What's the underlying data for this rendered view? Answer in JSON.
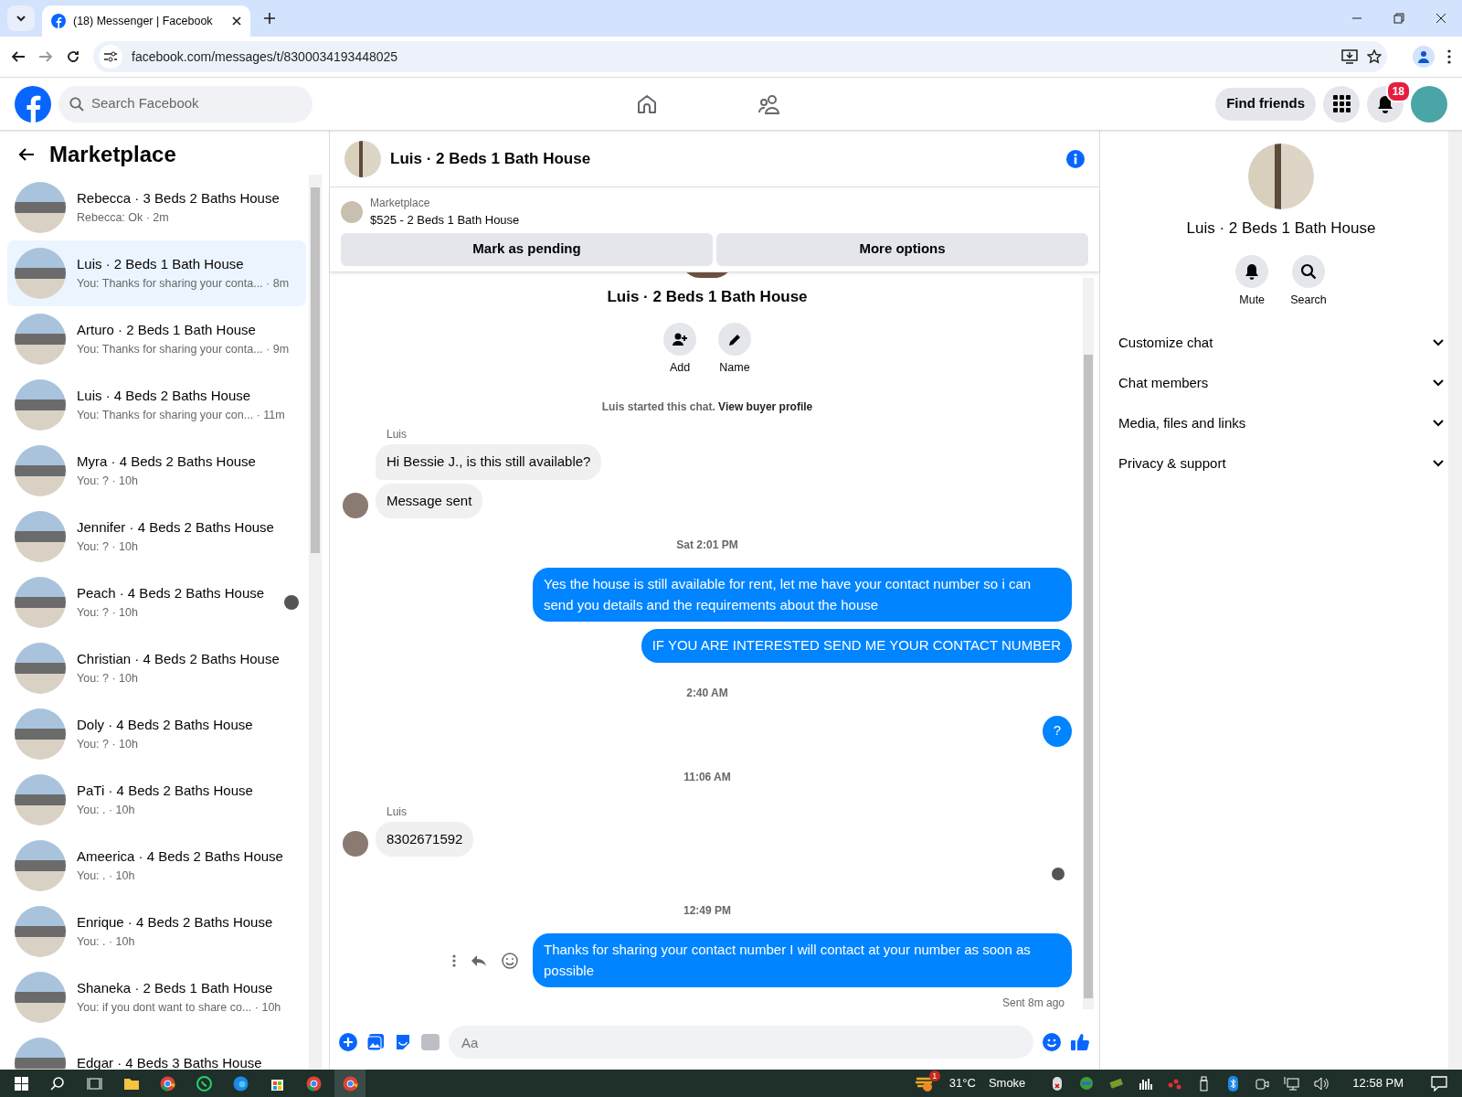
{
  "browser": {
    "tab_title": "(18) Messenger | Facebook",
    "url": "facebook.com/messages/t/8300034193448025"
  },
  "header": {
    "search_placeholder": "Search Facebook",
    "find_friends": "Find friends",
    "notification_count": "18"
  },
  "sidebar": {
    "title": "Marketplace",
    "conversations": [
      {
        "title": "Rebecca · 3 Beds 2 Baths House",
        "preview": "Rebecca: Ok · 2m",
        "selected": false,
        "unread_mark": false
      },
      {
        "title": "Luis · 2 Beds 1 Bath House",
        "preview": "You: Thanks for sharing your conta... · 8m",
        "selected": true,
        "unread_mark": false
      },
      {
        "title": "Arturo · 2 Beds 1 Bath House",
        "preview": "You: Thanks for sharing your conta... · 9m",
        "selected": false,
        "unread_mark": false
      },
      {
        "title": "Luis · 4 Beds 2 Baths House",
        "preview": "You: Thanks for sharing your con... · 11m",
        "selected": false,
        "unread_mark": false
      },
      {
        "title": "Myra · 4 Beds 2 Baths House",
        "preview": "You: ? · 10h",
        "selected": false,
        "unread_mark": false
      },
      {
        "title": "Jennifer · 4 Beds 2 Baths House",
        "preview": "You: ? · 10h",
        "selected": false,
        "unread_mark": false
      },
      {
        "title": "Peach · 4 Beds 2 Baths House",
        "preview": "You: ? · 10h",
        "selected": false,
        "unread_mark": true
      },
      {
        "title": "Christian · 4 Beds 2 Baths House",
        "preview": "You: ? · 10h",
        "selected": false,
        "unread_mark": false
      },
      {
        "title": "Doly · 4 Beds 2 Baths House",
        "preview": "You: ? · 10h",
        "selected": false,
        "unread_mark": false
      },
      {
        "title": "PaTi · 4 Beds 2 Baths House",
        "preview": "You: . · 10h",
        "selected": false,
        "unread_mark": false
      },
      {
        "title": "Ameerica · 4 Beds 2 Baths House",
        "preview": "You: . · 10h",
        "selected": false,
        "unread_mark": false
      },
      {
        "title": "Enrique · 4 Beds 2 Baths House",
        "preview": "You: . · 10h",
        "selected": false,
        "unread_mark": false
      },
      {
        "title": "Shaneka · 2 Beds 1 Bath House",
        "preview": "You: if you dont want to share co... · 10h",
        "selected": false,
        "unread_mark": false
      },
      {
        "title": "Edgar · 4 Beds 3 Baths House",
        "selected": false,
        "unread_mark": false
      }
    ]
  },
  "chat": {
    "title": "Luis · 2 Beds 1 Bath House",
    "listing": {
      "label": "Marketplace",
      "text": "$525 - 2 Beds 1 Bath House",
      "buttons": [
        "Mark as pending",
        "More options"
      ]
    },
    "intro": {
      "name": "Luis · 2 Beds 1 Bath House",
      "actions": [
        "Add",
        "Name"
      ],
      "started": "Luis started this chat.",
      "link": "View buyer profile"
    },
    "messages": [
      {
        "kind": "incoming",
        "sender": "Luis",
        "text": "Hi Bessie J., is this still available?",
        "avatar": false
      },
      {
        "kind": "incoming",
        "text": "Message sent",
        "avatar": true
      },
      {
        "kind": "timestamp",
        "text": "Sat 2:01 PM"
      },
      {
        "kind": "outgoing",
        "text": "Yes the house is still available for rent, let me have your contact number so i can send you details and the requirements about the house"
      },
      {
        "kind": "outgoing",
        "text": "IF YOU ARE INTERESTED SEND ME YOUR CONTACT NUMBER"
      },
      {
        "kind": "timestamp",
        "text": "2:40 AM"
      },
      {
        "kind": "outgoing",
        "text": "?"
      },
      {
        "kind": "timestamp",
        "text": "11:06 AM"
      },
      {
        "kind": "incoming",
        "sender": "Luis",
        "text": "8302671592",
        "avatar": true
      },
      {
        "kind": "seen"
      },
      {
        "kind": "timestamp",
        "text": "12:49 PM"
      },
      {
        "kind": "outgoing",
        "text": "Thanks for sharing your contact number I will contact at your number as soon as possible",
        "hover_actions": true
      },
      {
        "kind": "status",
        "text": "Sent 8m ago"
      }
    ],
    "composer_placeholder": "Aa"
  },
  "details": {
    "name": "Luis · 2 Beds 1 Bath House",
    "actions": [
      "Mute",
      "Search"
    ],
    "sections": [
      "Customize chat",
      "Chat members",
      "Media, files and links",
      "Privacy & support"
    ]
  },
  "taskbar": {
    "weather_badge": "1",
    "temperature": "31°C",
    "condition": "Smoke",
    "time": "12:58 PM"
  }
}
